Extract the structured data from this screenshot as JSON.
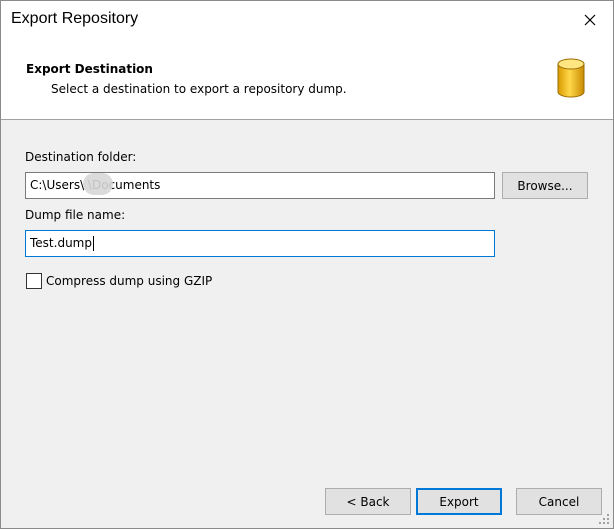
{
  "window": {
    "title": "Export Repository"
  },
  "header": {
    "title": "Export Destination",
    "subtitle": "Select a destination to export a repository dump.",
    "icon": "database-icon",
    "icon_color": "#f5c000"
  },
  "form": {
    "destination_label": "Destination folder:",
    "destination_value": "C:\\Users\\   \\Documents",
    "browse_label": "Browse...",
    "dump_name_label": "Dump file name:",
    "dump_name_value": "Test.dump",
    "compress_label": "Compress dump using GZIP",
    "compress_checked": false
  },
  "footer": {
    "back_label": "< Back",
    "export_label": "Export",
    "cancel_label": "Cancel"
  },
  "colors": {
    "focus_accent": "#0078d7",
    "dialog_background": "#f0f0f0",
    "header_background": "#ffffff"
  }
}
